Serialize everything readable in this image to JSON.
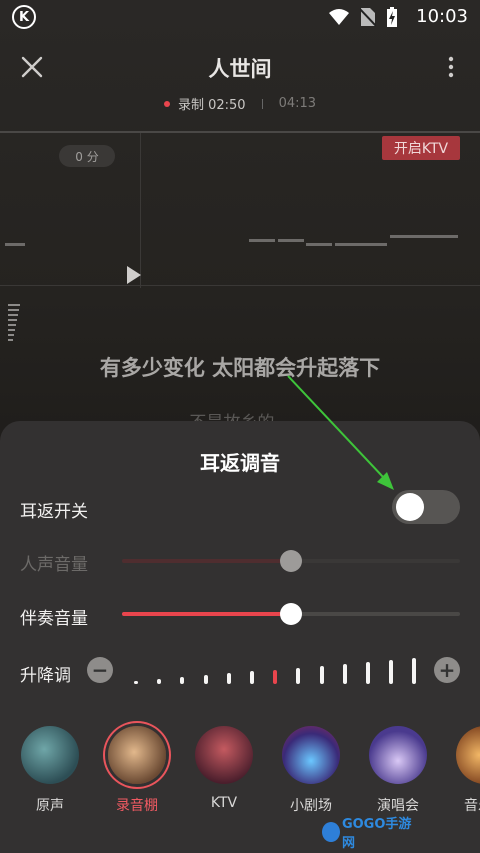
{
  "status_bar": {
    "app_badge": "K",
    "time": "10:03"
  },
  "header": {
    "title": "人世间",
    "recorded_label": "录制 02:50",
    "total_time": "04:13"
  },
  "pitch_area": {
    "score": "0 分",
    "ktv_button": "开启KTV"
  },
  "lyrics": {
    "current": "有多少变化 太阳都会升起落下",
    "next": "不是故乡的..."
  },
  "sheet": {
    "title": "耳返调音",
    "ear_return": {
      "label": "耳返开关",
      "on": false
    },
    "vocal_volume": {
      "label": "人声音量",
      "value": 0.5,
      "enabled": false
    },
    "accompaniment_volume": {
      "label": "伴奏音量",
      "value": 0.5
    },
    "pitch": {
      "label": "升降调",
      "minus": "−",
      "plus": "+",
      "current_index": 6,
      "steps": 13
    },
    "scenes": [
      {
        "label": "原声",
        "icon": "original-sound"
      },
      {
        "label": "录音棚",
        "icon": "studio-mic",
        "active": true
      },
      {
        "label": "KTV",
        "icon": "ktv-room"
      },
      {
        "label": "小剧场",
        "icon": "theater-stage"
      },
      {
        "label": "演唱会",
        "icon": "concert"
      },
      {
        "label": "音乐厅",
        "icon": "music-hall"
      }
    ]
  },
  "watermark": {
    "text": "GOGO手游网"
  },
  "colors": {
    "accent": "#e9454d",
    "sheet_bg": "#333131",
    "arrow": "#3ec43a"
  }
}
